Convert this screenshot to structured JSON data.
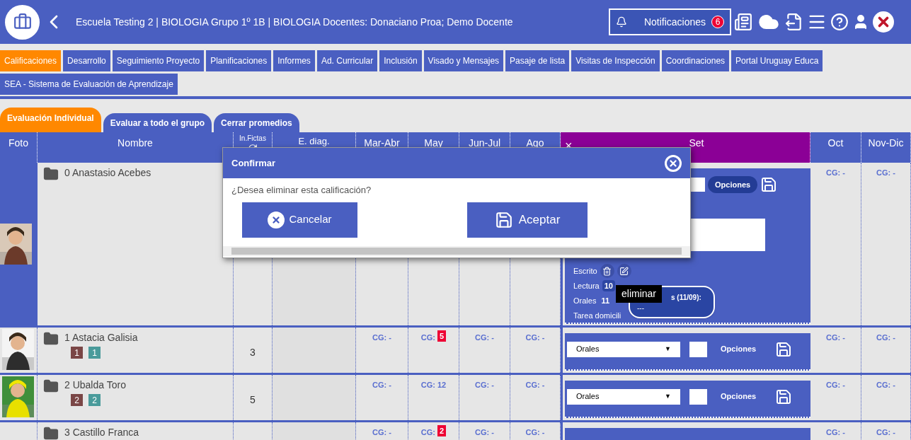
{
  "header": {
    "title": "Escuela Testing 2 | BIOLOGIA Grupo 1º 1B | BIOLOGIA Docentes: Donaciano Proa; Demo Docente",
    "notifications": {
      "label": "Notificaciones",
      "count": "6"
    }
  },
  "nav_tabs": [
    {
      "label": "Calificaciones",
      "selected": true
    },
    {
      "label": "Desarrollo",
      "selected": false
    },
    {
      "label": "Seguimiento Proyecto",
      "selected": false
    },
    {
      "label": "Planificaciones",
      "selected": false
    },
    {
      "label": "Informes",
      "selected": false
    },
    {
      "label": "Ad. Curricular",
      "selected": false
    },
    {
      "label": "Inclusión",
      "selected": false
    },
    {
      "label": "Visado y Mensajes",
      "selected": false
    },
    {
      "label": "Pasaje de lista",
      "selected": false
    },
    {
      "label": "Visitas de Inspección",
      "selected": false
    },
    {
      "label": "Coordinaciones",
      "selected": false
    },
    {
      "label": "Portal Uruguay Educa",
      "selected": false
    },
    {
      "label": "SEA - Sistema de Evaluación de Aprendizaje",
      "selected": false
    }
  ],
  "sub_tabs": [
    {
      "label": "Evaluación Individual",
      "selected": true
    },
    {
      "label": "Evaluar a todo el grupo",
      "selected": false
    },
    {
      "label": "Cerrar promedios",
      "selected": false
    }
  ],
  "table": {
    "columns": [
      {
        "label": "Foto",
        "kind": "plain",
        "selected": false
      },
      {
        "label": "Nombre",
        "kind": "plain",
        "selected": false
      },
      {
        "label": "In.Fictas",
        "kind": "icon",
        "selected": false
      },
      {
        "label": "E. diag.",
        "kind": "top",
        "selected": false
      },
      {
        "label": "Mar-Abr",
        "kind": "plain",
        "selected": false
      },
      {
        "label": "May",
        "kind": "plain",
        "selected": false
      },
      {
        "label": "Jun-Jul",
        "kind": "plain",
        "selected": false
      },
      {
        "label": "Ago",
        "kind": "plain",
        "selected": false
      },
      {
        "label": "Set",
        "kind": "plain",
        "selected": true,
        "close": "×"
      },
      {
        "label": "Oct",
        "kind": "plain",
        "selected": false
      },
      {
        "label": "Nov-Dic",
        "kind": "plain",
        "selected": false
      }
    ],
    "rows": [
      {
        "kind": "expanded",
        "photo": {
          "kind": "picture"
        },
        "name": "0 Anastasio Acebes",
        "grades": [],
        "set": {
          "kind": "detail",
          "button": "Opciones",
          "entries": [
            {
              "label": "Escrito",
              "kind": "actions"
            },
            {
              "label": "Lectura",
              "value": "10",
              "kind": "boxed"
            },
            {
              "label": "Orales",
              "value": "11",
              "kind": "bold"
            },
            {
              "label": "Tarea domicili",
              "kind": "plain"
            }
          ],
          "bubble": {
            "title": "s (11/09):",
            "body": "---"
          }
        },
        "late": [
          {
            "label": "CG:",
            "value": "-"
          },
          {
            "label": "CG:",
            "value": "-"
          }
        ]
      },
      {
        "kind": "normal",
        "photo": {
          "kind": "picture"
        },
        "name": "1 Astacia Galisia",
        "badges": [
          {
            "text": "1",
            "color": "#7a4646"
          },
          {
            "text": "1",
            "color": "#4a9b9b"
          }
        ],
        "fictas": "3",
        "grades": [
          {
            "label": "CG:",
            "value": "-",
            "flagged": false
          },
          {
            "label": "CG:",
            "value": "5",
            "flagged": true
          },
          {
            "label": "CG:",
            "value": "-",
            "flagged": false
          },
          {
            "label": "CG:",
            "value": "-",
            "flagged": false
          }
        ],
        "set": {
          "kind": "form",
          "select": "Orales",
          "arrow": "▼",
          "button": "Opciones"
        },
        "late": [
          {
            "label": "CG:",
            "value": "-"
          },
          {
            "label": "CG:",
            "value": "-"
          }
        ]
      },
      {
        "kind": "normal",
        "photo": {
          "kind": "picture"
        },
        "name": "2 Ubalda Toro",
        "badges": [
          {
            "text": "2",
            "color": "#7a4646"
          },
          {
            "text": "2",
            "color": "#4a9b9b"
          }
        ],
        "fictas": "5",
        "grades": [
          {
            "label": "CG:",
            "value": "-",
            "flagged": false
          },
          {
            "label": "CG:",
            "value": "12",
            "flagged": false
          },
          {
            "label": "CG:",
            "value": "-",
            "flagged": false
          },
          {
            "label": "CG:",
            "value": "-",
            "flagged": false
          }
        ],
        "set": {
          "kind": "form",
          "select": "Orales",
          "arrow": "▼",
          "button": "Opciones"
        },
        "late": [
          {
            "label": "CG:",
            "value": "-"
          },
          {
            "label": "CG:",
            "value": "-"
          }
        ]
      },
      {
        "kind": "normal",
        "name": "3 Castillo Franca",
        "grades": [
          {
            "label": "CG:",
            "value": "-",
            "flagged": false
          },
          {
            "label": "CG:",
            "value": "2",
            "flagged": true
          },
          {
            "label": "CG:",
            "value": "-",
            "flagged": false
          },
          {
            "label": "CG:",
            "value": "-",
            "flagged": false
          }
        ],
        "set": {
          "kind": "bar"
        },
        "late": [
          {
            "label": "CG:",
            "value": "-"
          },
          {
            "label": "CG:",
            "value": "-"
          }
        ]
      }
    ]
  },
  "modal": {
    "title": "Confirmar",
    "message": "¿Desea eliminar esta calificación?",
    "cancel": "Cancelar",
    "accept": "Aceptar"
  },
  "tooltip": "eliminar"
}
